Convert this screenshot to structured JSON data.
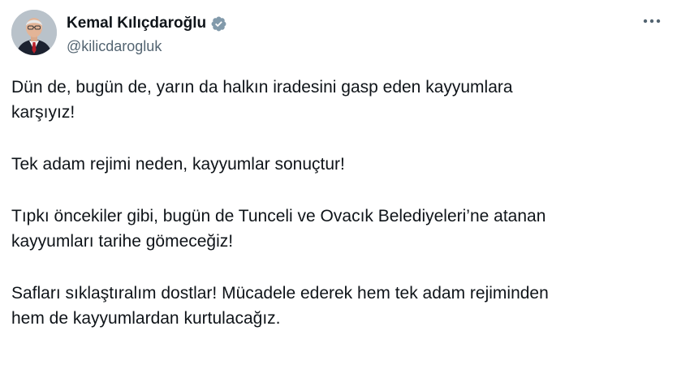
{
  "tweet": {
    "author": {
      "display_name": "Kemal Kılıçdaroğlu",
      "handle": "@kilicdarogluk",
      "verified_icon": "verified-badge-icon",
      "avatar_icon": "profile-photo"
    },
    "more_icon": "more-options-icon",
    "paragraphs": [
      {
        "lines": [
          "Dün de, bugün de, yarın da halkın iradesini gasp eden kayyumlara",
          "karşıyız!"
        ]
      },
      {
        "lines": [
          "Tek adam rejimi neden, kayyumlar sonuçtur!"
        ]
      },
      {
        "lines": [
          "Tıpkı öncekiler gibi, bugün de Tunceli ve Ovacık Belediyeleri’ne atanan",
          "kayyumları tarihe gömeceğiz!"
        ]
      },
      {
        "lines": [
          "Safları sıklaştıralım dostlar! Mücadele ederek hem tek adam rejiminden",
          "hem de kayyumlardan kurtulacağız."
        ]
      }
    ]
  },
  "colors": {
    "text_primary": "#0f1419",
    "text_secondary": "#536471",
    "verified_badge": "#829aab",
    "background": "#ffffff"
  }
}
